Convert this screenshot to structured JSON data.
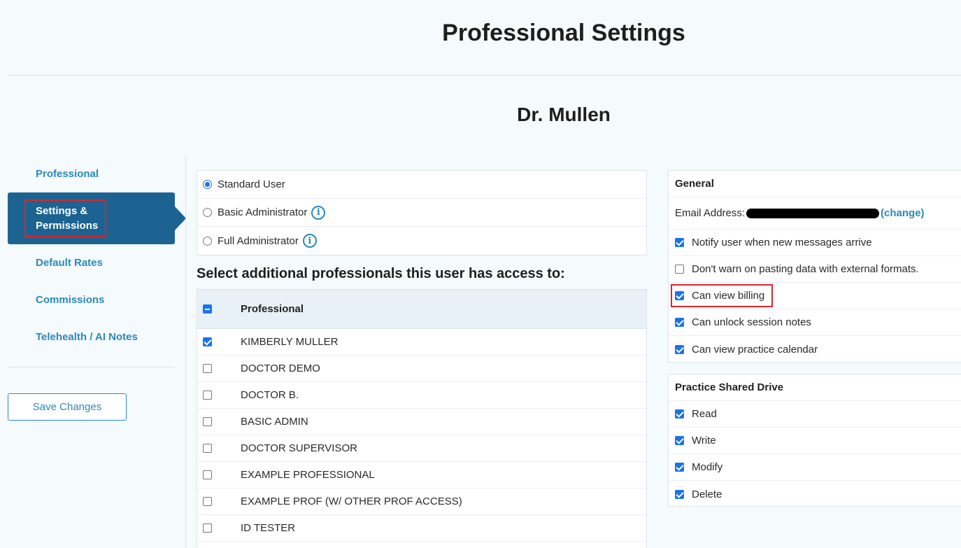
{
  "page": {
    "title": "Professional Settings",
    "user_name": "Dr. Mullen"
  },
  "sidebar": {
    "items": [
      {
        "label": "Professional",
        "active": false
      },
      {
        "label": "Settings & Permissions",
        "active": true,
        "highlighted": true
      },
      {
        "label": "Default Rates",
        "active": false
      },
      {
        "label": "Commissions",
        "active": false
      },
      {
        "label": "Telehealth / AI Notes",
        "active": false
      }
    ],
    "save_label": "Save Changes"
  },
  "roles": {
    "options": [
      {
        "label": "Standard User",
        "selected": true,
        "info_icon": false
      },
      {
        "label": "Basic Administrator",
        "selected": false,
        "info_icon": true
      },
      {
        "label": "Full Administrator",
        "selected": false,
        "info_icon": true
      }
    ]
  },
  "access": {
    "heading": "Select additional professionals this user has access to:",
    "column_header": "Professional",
    "header_checkbox": "mixed",
    "rows": [
      {
        "name": "KIMBERLY MULLER",
        "checked": true
      },
      {
        "name": "DOCTOR DEMO",
        "checked": false
      },
      {
        "name": "DOCTOR B.",
        "checked": false
      },
      {
        "name": "BASIC ADMIN",
        "checked": false
      },
      {
        "name": "DOCTOR SUPERVISOR",
        "checked": false
      },
      {
        "name": "EXAMPLE PROFESSIONAL",
        "checked": false
      },
      {
        "name": "EXAMPLE PROF (W/ OTHER PROF ACCESS)",
        "checked": false
      },
      {
        "name": "ID TESTER",
        "checked": false
      }
    ]
  },
  "general": {
    "title": "General",
    "email_label": "Email Address:",
    "change_label": "(change)",
    "permissions": [
      {
        "label": "Notify user when new messages arrive",
        "checked": true
      },
      {
        "label": "Don't warn on pasting data with external formats.",
        "checked": false
      },
      {
        "label": "Can view billing",
        "checked": true,
        "highlighted": true
      },
      {
        "label": "Can unlock session notes",
        "checked": true
      },
      {
        "label": "Can view practice calendar",
        "checked": true
      }
    ]
  },
  "drive": {
    "title": "Practice Shared Drive",
    "permissions": [
      {
        "label": "Read",
        "checked": true
      },
      {
        "label": "Write",
        "checked": true
      },
      {
        "label": "Modify",
        "checked": true
      },
      {
        "label": "Delete",
        "checked": true
      }
    ]
  },
  "colors": {
    "accent": "#2a8ab9",
    "active_nav": "#1d6391",
    "highlight": "#d8262c",
    "checkbox": "#1a73e8"
  }
}
